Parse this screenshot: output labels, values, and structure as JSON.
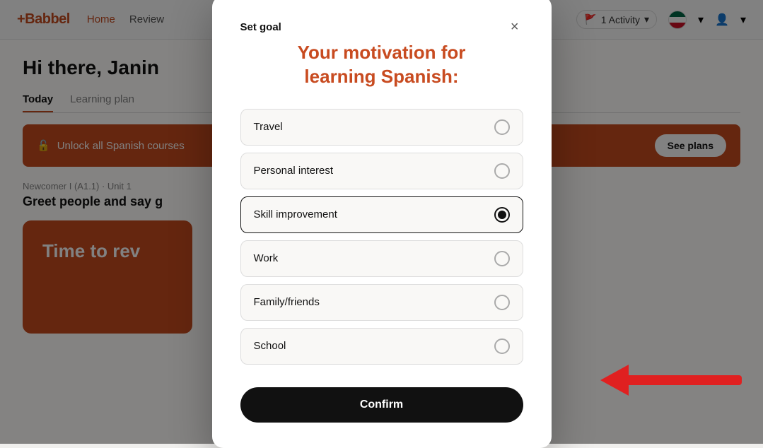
{
  "app": {
    "logo": "+Babbel",
    "nav": [
      "Home",
      "Review"
    ],
    "activity_btn": "1 Activity",
    "user_icon": "person"
  },
  "background": {
    "greeting": "Hi there, Janin",
    "tabs": [
      "Today",
      "Learning plan"
    ],
    "active_tab": "Today",
    "banner_text": "Unlock all Spanish courses",
    "see_plans_label": "See plans",
    "unit_label": "Newcomer I (A1.1) · Unit 1",
    "lesson_title": "Greet people and say g",
    "card_text": "Time to rev"
  },
  "modal": {
    "title": "Set goal",
    "heading_line1": "Your motivation for",
    "heading_line2": "learning Spanish:",
    "close_icon": "×",
    "options": [
      {
        "id": "travel",
        "label": "Travel",
        "selected": false
      },
      {
        "id": "personal-interest",
        "label": "Personal interest",
        "selected": false
      },
      {
        "id": "skill-improvement",
        "label": "Skill improvement",
        "selected": true
      },
      {
        "id": "work",
        "label": "Work",
        "selected": false
      },
      {
        "id": "family-friends",
        "label": "Family/friends",
        "selected": false
      },
      {
        "id": "school",
        "label": "School",
        "selected": false
      }
    ],
    "confirm_label": "Confirm"
  }
}
